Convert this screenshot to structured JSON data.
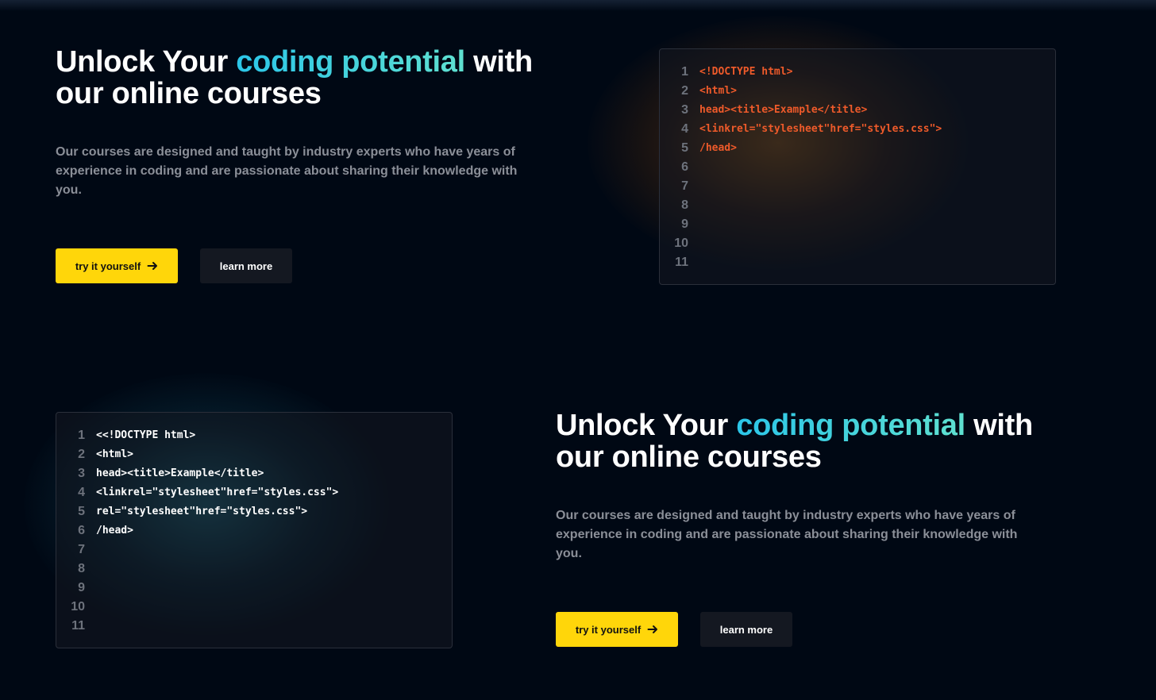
{
  "colors": {
    "background": "#000814",
    "accent_gradient_start": "#2bc6e8",
    "accent_gradient_end": "#5fe0d0",
    "primary_button": "#ffd60a",
    "secondary_button": "#141821",
    "code_orange": "#ee5a2a",
    "code_white": "#ffffff"
  },
  "section1": {
    "heading": {
      "prefix": "Unlock Your ",
      "accent": "coding potential",
      "suffix_line1": " with",
      "line2": "our online courses"
    },
    "description": "Our courses are designed and taught by industry experts who have years of experience in coding and are passionate about sharing their knowledge with you.",
    "primary_button": "try it yourself",
    "primary_button_icon": "arrow-right-icon",
    "secondary_button": "learn more",
    "editor": {
      "glow": "orange",
      "lines": [
        {
          "n": "1",
          "code": "<!DOCTYPE html>"
        },
        {
          "n": "2",
          "code": "<html>"
        },
        {
          "n": "3",
          "code": "head><title>Example</title>"
        },
        {
          "n": "4",
          "code": "<linkrel=\"stylesheet\"href=\"styles.css\">"
        },
        {
          "n": "5",
          "code": "/head>"
        },
        {
          "n": "6",
          "code": ""
        },
        {
          "n": "7",
          "code": ""
        },
        {
          "n": "8",
          "code": ""
        },
        {
          "n": "9",
          "code": ""
        },
        {
          "n": "10",
          "code": ""
        },
        {
          "n": "11",
          "code": ""
        }
      ]
    }
  },
  "section2": {
    "heading": {
      "prefix": "Unlock Your ",
      "accent": "coding potential",
      "suffix_line1": " with",
      "line2": "our online courses"
    },
    "description": "Our courses are designed and taught by industry experts who have years of experience in coding and are passionate about sharing their knowledge with you.",
    "primary_button": "try it yourself",
    "primary_button_icon": "arrow-right-icon",
    "secondary_button": "learn more",
    "editor": {
      "glow": "teal",
      "lines": [
        {
          "n": "1",
          "code": "<<!DOCTYPE html>"
        },
        {
          "n": "2",
          "code": "<html>"
        },
        {
          "n": "3",
          "code": "head><title>Example</title>"
        },
        {
          "n": "4",
          "code": "<linkrel=\"stylesheet\"href=\"styles.css\">"
        },
        {
          "n": "5",
          "code": "rel=\"stylesheet\"href=\"styles.css\">"
        },
        {
          "n": "6",
          "code": "/head>"
        },
        {
          "n": "7",
          "code": ""
        },
        {
          "n": "8",
          "code": ""
        },
        {
          "n": "9",
          "code": ""
        },
        {
          "n": "10",
          "code": ""
        },
        {
          "n": "11",
          "code": ""
        }
      ]
    }
  }
}
